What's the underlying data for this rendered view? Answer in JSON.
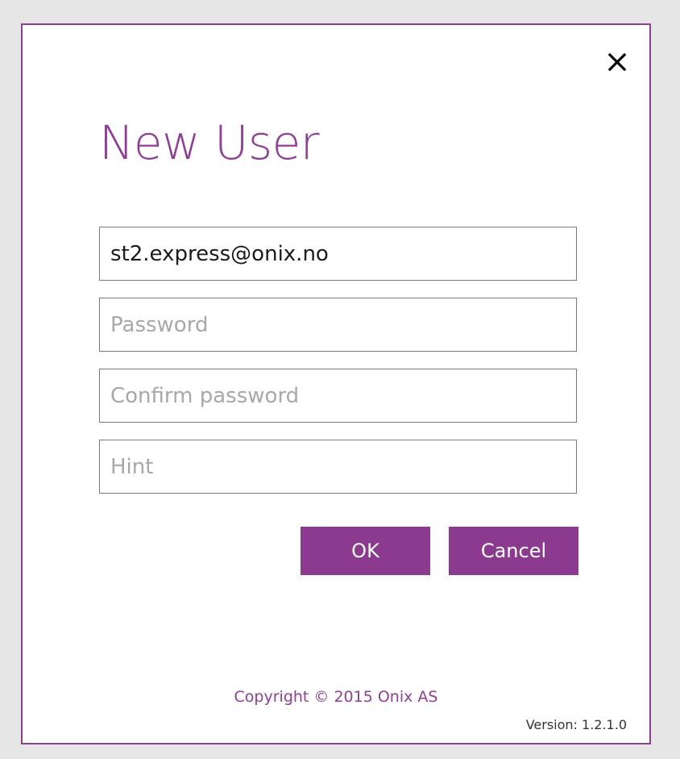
{
  "dialog": {
    "title": "New User",
    "close_icon": "close-icon",
    "accent_color": "#8e3f93",
    "fields": {
      "email": {
        "value": "st2.express@onix.no",
        "placeholder": ""
      },
      "password": {
        "value": "",
        "placeholder": "Password"
      },
      "confirm_password": {
        "value": "",
        "placeholder": "Confirm password"
      },
      "hint": {
        "value": "",
        "placeholder": "Hint"
      }
    },
    "buttons": {
      "ok_label": "OK",
      "cancel_label": "Cancel"
    },
    "footer": {
      "copyright": "Copyright © 2015 Onix AS",
      "version": "Version: 1.2.1.0"
    }
  }
}
